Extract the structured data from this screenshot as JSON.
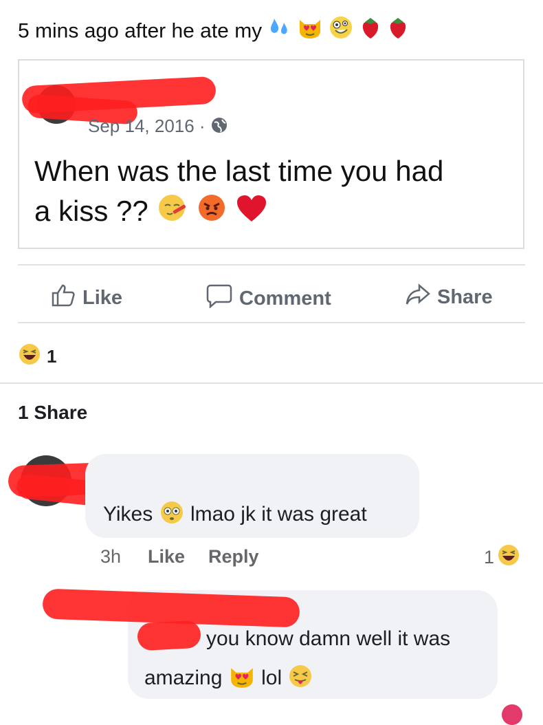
{
  "caption": {
    "text": "5 mins ago after he ate my",
    "emojis": [
      "sweat-droplets",
      "heart-eyes-cat",
      "zany-face",
      "strawberry",
      "strawberry"
    ]
  },
  "shared_post": {
    "date": "Sep 14, 2016 ·",
    "privacy_icon": "globe-icon",
    "line1": "When was the last time you had",
    "line2": "a kiss ??",
    "emojis": [
      "face-with-thermometer",
      "angry-face",
      "red-heart"
    ]
  },
  "actions": {
    "like": "Like",
    "comment": "Comment",
    "share": "Share"
  },
  "reactions": {
    "count": "1",
    "emoji": "laughing-face"
  },
  "shares": {
    "text": "1 Share"
  },
  "comment1": {
    "text_a": "Yikes",
    "text_b": "lmao jk it was great",
    "emoji": "flushed-face",
    "time": "3h",
    "like": "Like",
    "reply": "Reply",
    "reaction_count": "1",
    "reaction_emoji": "laughing-face"
  },
  "comment2": {
    "line1": "you know damn well it was",
    "line2_a": "amazing",
    "line2_b": "lol",
    "emojis": [
      "heart-eyes-cat",
      "squinting-tongue-face"
    ]
  },
  "colors": {
    "redaction": "#ff1f1f",
    "bubble": "#f0f2f5",
    "muted": "#65676b"
  }
}
